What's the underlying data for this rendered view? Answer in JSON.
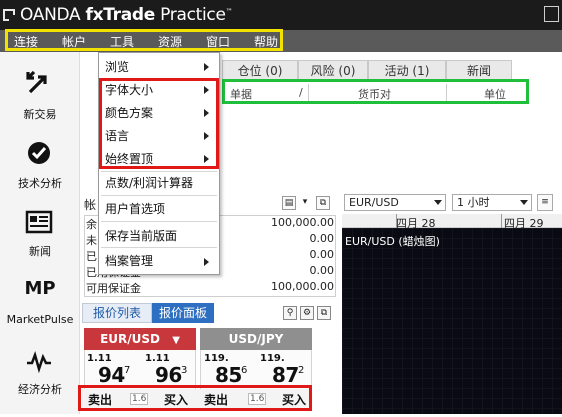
{
  "app": {
    "brand": "OANDA",
    "product": "fxTrade",
    "edition": "Practice"
  },
  "menubar": [
    "连接",
    "帐户",
    "工具",
    "资源",
    "窗口",
    "帮助"
  ],
  "dropdown": {
    "items": [
      {
        "label": "浏览",
        "submenu": true
      },
      {
        "label": "字体大小",
        "submenu": true
      },
      {
        "label": "颜色方案",
        "submenu": true
      },
      {
        "label": "语言",
        "submenu": true
      },
      {
        "label": "始终置顶",
        "submenu": true
      },
      {
        "label": "点数/利润计算器",
        "submenu": false
      },
      {
        "label": "用户首选项",
        "submenu": false
      },
      {
        "label": "保存当前版面",
        "submenu": false
      },
      {
        "label": "档案管理",
        "submenu": true
      }
    ]
  },
  "leftnav": [
    {
      "label": "新交易",
      "icon": "new-trade-icon"
    },
    {
      "label": "技术分析",
      "icon": "technical-analysis-icon"
    },
    {
      "label": "新闻",
      "icon": "news-icon"
    },
    {
      "label": "MarketPulse",
      "icon": "marketpulse-icon"
    },
    {
      "label": "经济分析",
      "icon": "economic-analysis-icon"
    }
  ],
  "trade_tabs": [
    "仓位 (0)",
    "风险 (0)",
    "活动 (1)",
    "新闻"
  ],
  "order_table": {
    "columns": [
      "单据",
      "/",
      "货币对",
      "单位"
    ]
  },
  "account": {
    "title_fragment": "帐",
    "rows": [
      {
        "label": "余",
        "value": "100,000.00"
      },
      {
        "label": "未",
        "value": "0.00"
      },
      {
        "label": "已",
        "value": "0.00"
      },
      {
        "label": "已用保证金",
        "value": "0.00"
      },
      {
        "label": "可用保证金",
        "value": "100,000.00"
      }
    ]
  },
  "quote_tabs": [
    "报价列表",
    "报价面板"
  ],
  "quotes": [
    {
      "pair": "EUR/USD",
      "color": "#c8373b",
      "sell": {
        "prefix": "1.11",
        "big": "94",
        "pip": "7"
      },
      "buy": {
        "prefix": "1.11",
        "big": "96",
        "pip": "3"
      },
      "sell_label": "卖出",
      "spread": "1.6",
      "buy_label": "买入"
    },
    {
      "pair": "USD/JPY",
      "color": "#8f8f8f",
      "sell": {
        "prefix": "119.",
        "big": "85",
        "pip": "6"
      },
      "buy": {
        "prefix": "119.",
        "big": "87",
        "pip": "2"
      },
      "sell_label": "卖出",
      "spread": "1.6",
      "buy_label": "买入"
    }
  ],
  "chart": {
    "instrument": "EUR/USD",
    "timeframe": "1 小时",
    "dates": [
      "四月 28",
      "四月 29"
    ],
    "title": "EUR/USD (蜡烛图)"
  },
  "colors": {
    "menubar_highlight": "#f2e200",
    "annotation_red": "#e01818",
    "annotation_green": "#1fbf3c",
    "accent_blue": "#2f6fc2"
  }
}
